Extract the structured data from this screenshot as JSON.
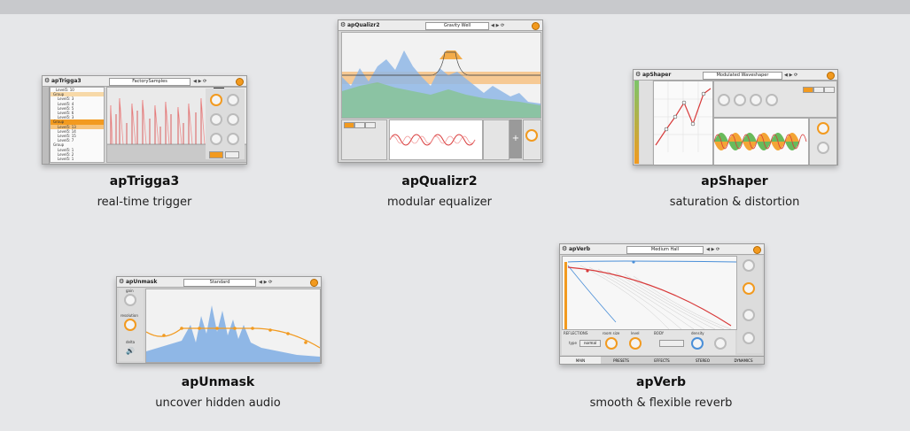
{
  "plugins": [
    {
      "id": "trigga",
      "title": "apTrigga3",
      "subtitle": "real-time trigger",
      "window_name": "apTrigga3",
      "preset": "FactorySamples",
      "rows": [
        "Level5: 10",
        "Group",
        "Level5: 3",
        "Level5: 4",
        "Level5: 5",
        "Level5: 6",
        "Level5: 3",
        "Group",
        "Level5: 13",
        "Level5: 14",
        "Level5: 15",
        "Level5: 7",
        "Group",
        "Level5: 1",
        "Level5: 2",
        "Level5: 1"
      ]
    },
    {
      "id": "qualizr",
      "title": "apQualizr2",
      "subtitle": "modular equalizer",
      "window_name": "apQualizr2",
      "preset": "Gravity Well"
    },
    {
      "id": "shaper",
      "title": "apShaper",
      "subtitle": "saturation & distortion",
      "window_name": "apShaper",
      "preset": "Modulated Waveshaper"
    },
    {
      "id": "unmask",
      "title": "apUnmask",
      "subtitle": "uncover hidden audio",
      "window_name": "apUnmask",
      "preset": "Standard",
      "knobs": [
        "gain",
        "resolution",
        "delta"
      ]
    },
    {
      "id": "verb",
      "title": "apVerb",
      "subtitle": "smooth & flexible reverb",
      "window_name": "apVerb",
      "preset": "Medium Hall",
      "tabs": [
        "MAIN",
        "PRESETS",
        "EFFECTS",
        "STEREO",
        "DYNAMICS"
      ],
      "section_reflections": "REFLECTIONS",
      "section_body": "BODY",
      "room_size": "room size",
      "level": "level",
      "density": "density",
      "type_label": "type",
      "type_value": "normal"
    }
  ],
  "colors": {
    "accent": "#f29a1f",
    "blue": "#4a8fd8",
    "red": "#d83a3a",
    "green": "#59b24a"
  }
}
